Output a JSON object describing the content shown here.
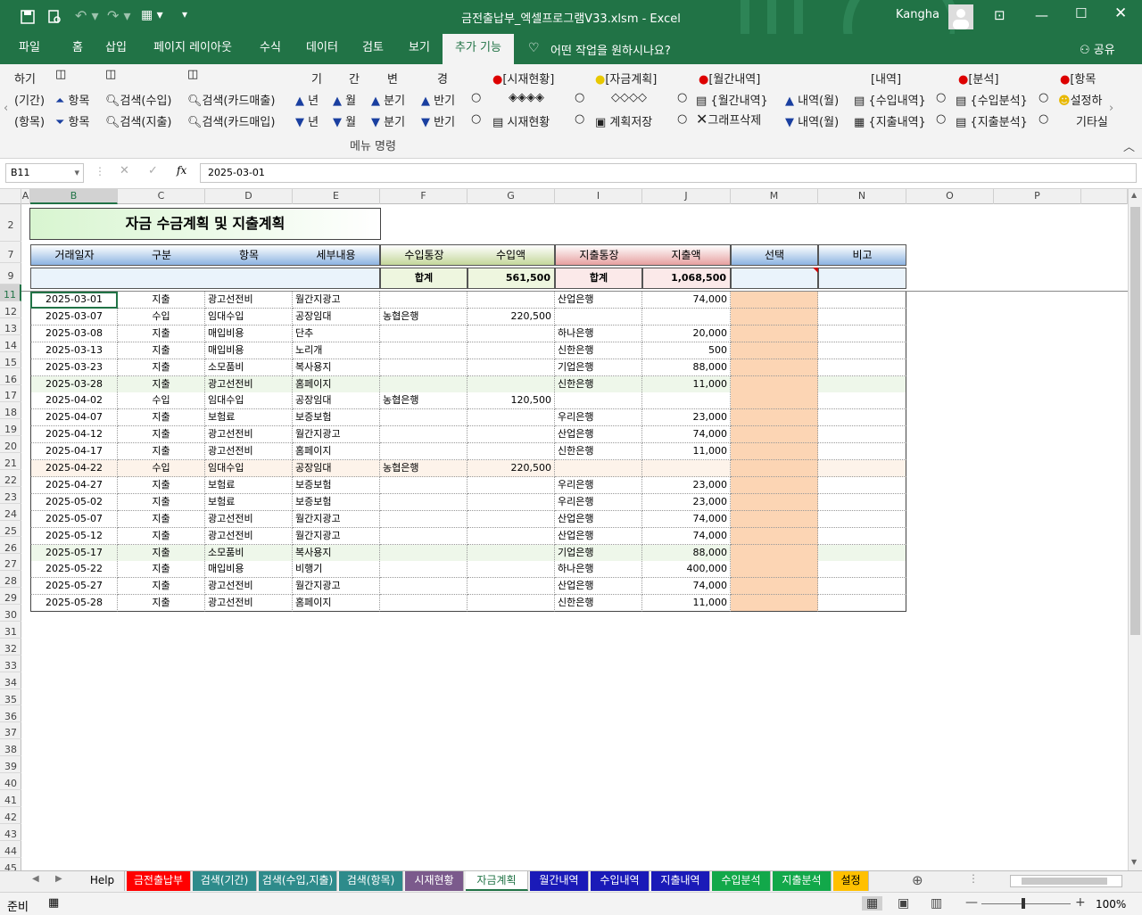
{
  "window": {
    "title": "금전출납부_엑셀프로그램V33.xlsm  -  Excel",
    "user": "Kangha"
  },
  "ribbon_tabs": [
    "파일",
    "홈",
    "삽입",
    "페이지 레이아웃",
    "수식",
    "데이터",
    "검토",
    "보기",
    "추가 기능"
  ],
  "tellme": "어떤 작업을 원하시나요?",
  "share": "공유",
  "ribbon": {
    "row1": [
      "하기",
      "기",
      "간",
      "변",
      "경",
      "[시재현황]",
      "[자금계획]",
      "[월간내역]",
      "[내역]",
      "[분석]",
      "[항목"
    ],
    "row2": [
      "(기간)",
      "항목",
      "검색(수입)",
      "검색(카드매출)",
      "년",
      "월",
      "분기",
      "반기",
      "◈◈◈◈",
      "◇◇◇◇",
      "{월간내역}",
      "내역(월)",
      "{수입내역}",
      "{수입분석}",
      "설정하"
    ],
    "row3": [
      "(항목)",
      "항목",
      "검색(지출)",
      "검색(카드매입)",
      "년",
      "월",
      "분기",
      "반기",
      "시재현황",
      "계획저장",
      "그래프삭제",
      "내역(월)",
      "{지출내역}",
      "{지출분석}",
      "기타실"
    ],
    "group_label": "메뉴 명령"
  },
  "formula": {
    "namebox": "B11",
    "value": "2025-03-01",
    "fx": "fx"
  },
  "columns": [
    "A",
    "B",
    "C",
    "D",
    "E",
    "F",
    "G",
    "I",
    "J",
    "M",
    "N",
    "O",
    "P"
  ],
  "rows": [
    "2",
    "7",
    "9",
    "11",
    "12",
    "13",
    "14",
    "15",
    "16",
    "17",
    "18",
    "19",
    "20",
    "21",
    "22",
    "23",
    "24",
    "25",
    "26",
    "27",
    "28",
    "29",
    "30",
    "31",
    "32",
    "33",
    "34",
    "35",
    "36",
    "37",
    "38",
    "39",
    "40",
    "41",
    "42",
    "43",
    "44",
    "45"
  ],
  "sheet_title": "자금 수금계획 및 지출계획",
  "headers": [
    "거래일자",
    "구분",
    "항목",
    "세부내용",
    "수입통장",
    "수입액",
    "지출통장",
    "지출액",
    "선택",
    "비고"
  ],
  "totals": {
    "in_label": "합계",
    "in_value": "561,500",
    "out_label": "합계",
    "out_value": "1,068,500"
  },
  "table": [
    [
      "2025-03-01",
      "지출",
      "광고선전비",
      "월간지광고",
      "",
      "",
      "산업은행",
      "74,000"
    ],
    [
      "2025-03-07",
      "수입",
      "임대수입",
      "공장임대",
      "농협은행",
      "220,500",
      "",
      ""
    ],
    [
      "2025-03-08",
      "지출",
      "매입비용",
      "단추",
      "",
      "",
      "하나은행",
      "20,000"
    ],
    [
      "2025-03-13",
      "지출",
      "매입비용",
      "노리개",
      "",
      "",
      "신한은행",
      "500"
    ],
    [
      "2025-03-23",
      "지출",
      "소모품비",
      "복사용지",
      "",
      "",
      "기업은행",
      "88,000"
    ],
    [
      "2025-03-28",
      "지출",
      "광고선전비",
      "홈페이지",
      "",
      "",
      "신한은행",
      "11,000"
    ],
    [
      "2025-04-02",
      "수입",
      "임대수입",
      "공장임대",
      "농협은행",
      "120,500",
      "",
      ""
    ],
    [
      "2025-04-07",
      "지출",
      "보험료",
      "보증보험",
      "",
      "",
      "우리은행",
      "23,000"
    ],
    [
      "2025-04-12",
      "지출",
      "광고선전비",
      "월간지광고",
      "",
      "",
      "산업은행",
      "74,000"
    ],
    [
      "2025-04-17",
      "지출",
      "광고선전비",
      "홈페이지",
      "",
      "",
      "신한은행",
      "11,000"
    ],
    [
      "2025-04-22",
      "수입",
      "임대수입",
      "공장임대",
      "농협은행",
      "220,500",
      "",
      ""
    ],
    [
      "2025-04-27",
      "지출",
      "보험료",
      "보증보험",
      "",
      "",
      "우리은행",
      "23,000"
    ],
    [
      "2025-05-02",
      "지출",
      "보험료",
      "보증보험",
      "",
      "",
      "우리은행",
      "23,000"
    ],
    [
      "2025-05-07",
      "지출",
      "광고선전비",
      "월간지광고",
      "",
      "",
      "산업은행",
      "74,000"
    ],
    [
      "2025-05-12",
      "지출",
      "광고선전비",
      "월간지광고",
      "",
      "",
      "산업은행",
      "74,000"
    ],
    [
      "2025-05-17",
      "지출",
      "소모품비",
      "복사용지",
      "",
      "",
      "기업은행",
      "88,000"
    ],
    [
      "2025-05-22",
      "지출",
      "매입비용",
      "비행기",
      "",
      "",
      "하나은행",
      "400,000"
    ],
    [
      "2025-05-27",
      "지출",
      "광고선전비",
      "월간지광고",
      "",
      "",
      "산업은행",
      "74,000"
    ],
    [
      "2025-05-28",
      "지출",
      "광고선전비",
      "홈페이지",
      "",
      "",
      "신한은행",
      "11,000"
    ]
  ],
  "sheet_tabs": [
    {
      "label": "Help",
      "bg": "#f0f0f0",
      "fg": "#000"
    },
    {
      "label": "금전출납부",
      "bg": "#ff0000",
      "fg": "#fff"
    },
    {
      "label": "검색(기간)",
      "bg": "#2e8b8b",
      "fg": "#fff"
    },
    {
      "label": "검색(수입,지출)",
      "bg": "#2e8b8b",
      "fg": "#fff"
    },
    {
      "label": "검색(항목)",
      "bg": "#2e8b8b",
      "fg": "#fff"
    },
    {
      "label": "시재현황",
      "bg": "#7b5a8c",
      "fg": "#fff"
    },
    {
      "label": "자금계획",
      "bg": "#ffffff",
      "fg": "#217346"
    },
    {
      "label": "월간내역",
      "bg": "#1a1ab8",
      "fg": "#fff"
    },
    {
      "label": "수입내역",
      "bg": "#1a1ab8",
      "fg": "#fff"
    },
    {
      "label": "지출내역",
      "bg": "#1a1ab8",
      "fg": "#fff"
    },
    {
      "label": "수입분석",
      "bg": "#12a84a",
      "fg": "#fff"
    },
    {
      "label": "지출분석",
      "bg": "#12a84a",
      "fg": "#fff"
    },
    {
      "label": "설정",
      "bg": "#ffc000",
      "fg": "#000"
    }
  ],
  "status": {
    "left": "준비",
    "zoom": "100%"
  },
  "colors": {
    "excel_green": "#217346",
    "header_blue": "#8db4e2",
    "income_green": "#c4d79b",
    "expense_red": "#e6a0a0",
    "select_orange": "#fcd5b4"
  }
}
